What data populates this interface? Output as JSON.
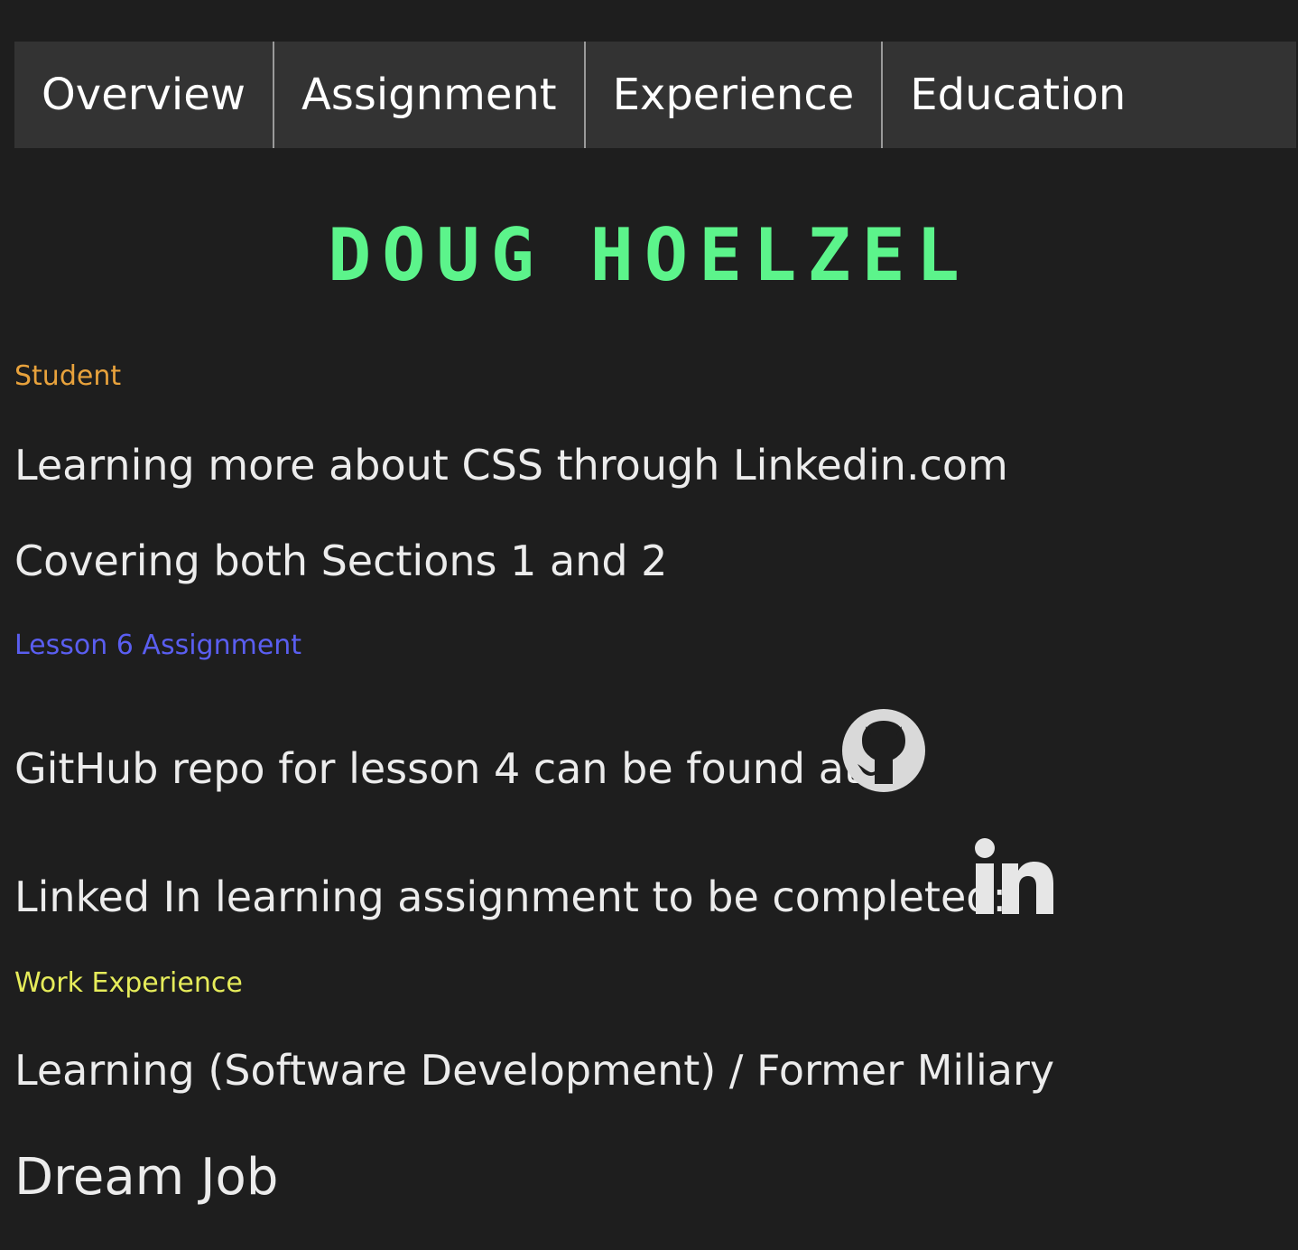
{
  "nav": {
    "items": [
      {
        "label": "Overview"
      },
      {
        "label": "Assignment"
      },
      {
        "label": "Experience"
      },
      {
        "label": "Education"
      }
    ]
  },
  "header": {
    "first_name": "DOUG",
    "last_name": "HOELZEL",
    "title_color": "#5cf48b"
  },
  "sections": {
    "student": {
      "label": "Student",
      "label_color": "#e8a23c",
      "line1": "Learning more about CSS through Linkedin.com",
      "line2": "Covering both Sections 1 and 2"
    },
    "assignment": {
      "label": "Lesson 6 Assignment",
      "label_color": "#5a5ef0",
      "github_text": "GitHub repo for lesson 4 can be found at:",
      "github_icon": "github-icon",
      "linkedin_text": "Linked In learning assignment to be completed:",
      "linkedin_icon": "linkedin-icon"
    },
    "work": {
      "label": "Work Experience",
      "label_color": "#e6ec5a",
      "line1": "Learning (Software Development) / Former Miliary",
      "line2": "Dream Job"
    }
  },
  "colors": {
    "background": "#1e1e1e",
    "nav_background": "#333333",
    "text": "#ececec",
    "icon": "#d9d9d9"
  }
}
